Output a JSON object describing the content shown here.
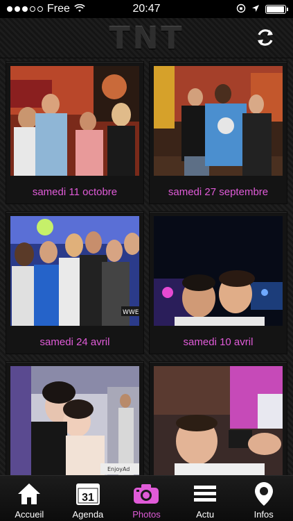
{
  "status_bar": {
    "carrier": "Free",
    "time": "20:47",
    "battery_level": 0.95
  },
  "header": {
    "logo_text": "TNT",
    "refresh_icon": "refresh-icon"
  },
  "albums": [
    {
      "date": "samedi 11 octobre"
    },
    {
      "date": "samedi 27 septembre"
    },
    {
      "date": "samedi 24 avril"
    },
    {
      "date": "samedi 10 avril"
    },
    {
      "date": ""
    },
    {
      "date": ""
    }
  ],
  "photo_watermarks": {
    "album3": "WWEMO",
    "album5": "EnjoyAd"
  },
  "tabs": [
    {
      "label": "Accueil",
      "icon": "home-icon"
    },
    {
      "label": "Agenda",
      "icon": "calendar-icon",
      "calendar_day": "31"
    },
    {
      "label": "Photos",
      "icon": "camera-icon"
    },
    {
      "label": "Actu",
      "icon": "menu-lines-icon"
    },
    {
      "label": "Infos",
      "icon": "location-pin-icon"
    }
  ],
  "colors": {
    "accent": "#e05bd8",
    "background": "#1a1a1a",
    "tab_text": "#ffffff"
  }
}
